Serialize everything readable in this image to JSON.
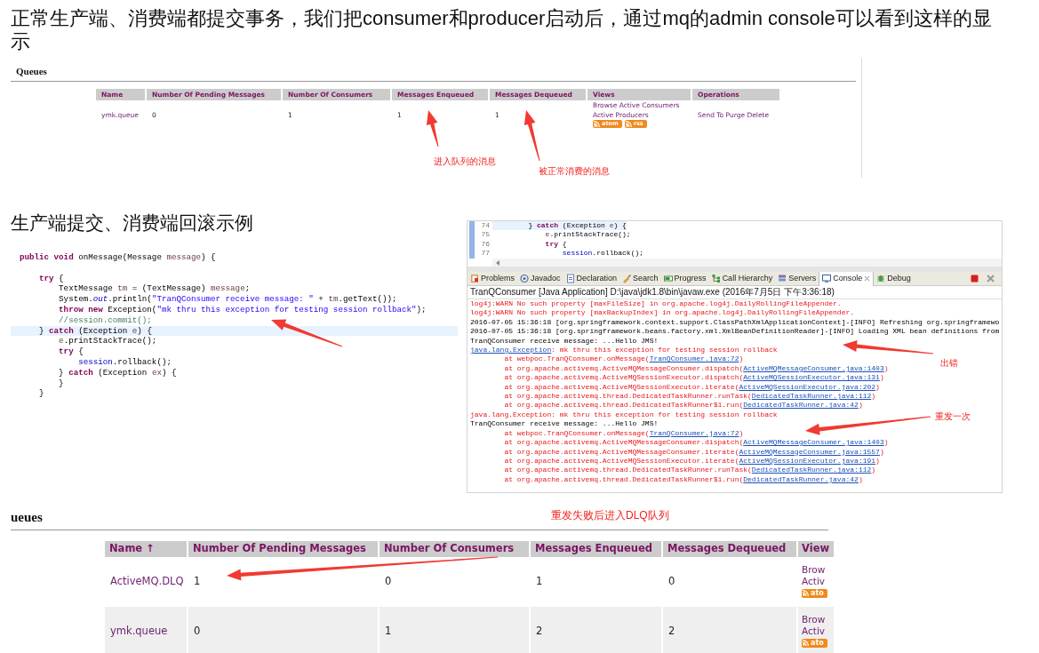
{
  "intro": "正常生产端、消费端都提交事务，我们把consumer和producer启动后，通过mq的admin console可以看到这样的显示",
  "queues_top": {
    "title": "Queues",
    "columns": [
      "Name",
      "Number Of Pending Messages",
      "Number Of Consumers",
      "Messages Enqueued",
      "Messages Dequeued",
      "Views",
      "Operations"
    ],
    "rows": [
      {
        "name": "ymk.queue",
        "pending": "0",
        "consumers": "1",
        "enqueued": "1",
        "dequeued": "1",
        "views": [
          "Browse Active Consumers",
          "Active Producers"
        ],
        "feeds": [
          "atom",
          "rss"
        ],
        "operations": [
          "Send To",
          "Purge",
          "Delete"
        ]
      }
    ]
  },
  "subtitle": "生产端提交、消费端回滚示例",
  "code": {
    "lines": [
      {
        "current": false,
        "tokens": [
          {
            "kind": "kw",
            "text": "public void"
          },
          {
            "kind": "p",
            "text": " onMessage(Message "
          },
          {
            "kind": "var",
            "text": "message"
          },
          {
            "kind": "p",
            "text": ") {"
          }
        ]
      },
      {
        "current": false,
        "tokens": [
          {
            "kind": "kw",
            "text": "    try"
          },
          {
            "kind": "p",
            "text": " {"
          }
        ]
      },
      {
        "current": false,
        "tokens": [
          {
            "kind": "p",
            "text": "        TextMessage "
          },
          {
            "kind": "var",
            "text": "tm"
          },
          {
            "kind": "p",
            "text": " = (TextMessage) "
          },
          {
            "kind": "var",
            "text": "message"
          },
          {
            "kind": "p",
            "text": ";"
          }
        ]
      },
      {
        "current": false,
        "tokens": [
          {
            "kind": "p",
            "text": "        System."
          },
          {
            "kind": "sf",
            "text": "out"
          },
          {
            "kind": "p",
            "text": ".println("
          },
          {
            "kind": "str",
            "text": "\"TranQConsumer receive message: \""
          },
          {
            "kind": "p",
            "text": " + "
          },
          {
            "kind": "var",
            "text": "tm"
          },
          {
            "kind": "p",
            "text": ".getText());"
          }
        ]
      },
      {
        "current": false,
        "tokens": [
          {
            "kind": "kw",
            "text": "        throw new"
          },
          {
            "kind": "p",
            "text": " Exception("
          },
          {
            "kind": "str",
            "text": "\"mk thru this exception for testing session rollback\""
          },
          {
            "kind": "p",
            "text": ");"
          }
        ]
      },
      {
        "current": false,
        "tokens": [
          {
            "kind": "cmt",
            "text": "        //session.commit();"
          }
        ]
      },
      {
        "current": true,
        "tokens": [
          {
            "kind": "p",
            "text": "    } "
          },
          {
            "kind": "kw",
            "text": "catch"
          },
          {
            "kind": "p",
            "text": " (Exception "
          },
          {
            "kind": "var",
            "text": "e"
          },
          {
            "kind": "p",
            "text": ") {"
          }
        ]
      },
      {
        "current": false,
        "tokens": [
          {
            "kind": "var",
            "text": "        e"
          },
          {
            "kind": "p",
            "text": ".printStackTrace();"
          }
        ]
      },
      {
        "current": false,
        "tokens": [
          {
            "kind": "kw",
            "text": "        try"
          },
          {
            "kind": "p",
            "text": " {"
          }
        ]
      },
      {
        "current": false,
        "tokens": [
          {
            "kind": "f",
            "text": "            session"
          },
          {
            "kind": "p",
            "text": ".rollback();"
          }
        ]
      },
      {
        "current": false,
        "tokens": [
          {
            "kind": "p",
            "text": "        } "
          },
          {
            "kind": "kw",
            "text": "catch"
          },
          {
            "kind": "p",
            "text": " (Exception "
          },
          {
            "kind": "var",
            "text": "ex"
          },
          {
            "kind": "p",
            "text": ") {"
          }
        ]
      },
      {
        "current": false,
        "tokens": [
          {
            "kind": "p",
            "text": "        }"
          }
        ]
      },
      {
        "current": false,
        "tokens": [
          {
            "kind": "p",
            "text": "    }"
          }
        ]
      }
    ]
  },
  "eclipse": {
    "editor_lines": [
      {
        "number": "74",
        "current": true,
        "tokens": [
          {
            "kind": "p",
            "text": "        } "
          },
          {
            "kind": "kw",
            "text": "catch"
          },
          {
            "kind": "p",
            "text": " (Exception "
          },
          {
            "kind": "var",
            "text": "e"
          },
          {
            "kind": "p",
            "text": ") {"
          }
        ]
      },
      {
        "number": "75",
        "current": false,
        "tokens": [
          {
            "kind": "var",
            "text": "            e"
          },
          {
            "kind": "p",
            "text": ".printStackTrace();"
          }
        ]
      },
      {
        "number": "76",
        "current": false,
        "tokens": [
          {
            "kind": "kw",
            "text": "            try"
          },
          {
            "kind": "p",
            "text": " {"
          }
        ]
      },
      {
        "number": "77",
        "current": false,
        "tokens": [
          {
            "kind": "f",
            "text": "                session"
          },
          {
            "kind": "p",
            "text": ".rollback();"
          }
        ]
      }
    ],
    "tabs": [
      {
        "label": "Problems",
        "selected": false
      },
      {
        "label": "Javadoc",
        "selected": false
      },
      {
        "label": "Declaration",
        "selected": false
      },
      {
        "label": "Search",
        "selected": false
      },
      {
        "label": "Progress",
        "selected": false
      },
      {
        "label": "Call Hierarchy",
        "selected": false
      },
      {
        "label": "Servers",
        "selected": false
      },
      {
        "label": "Console",
        "selected": true
      },
      {
        "label": "Debug",
        "selected": false
      }
    ],
    "console_title": "TranQConsumer [Java Application] D:\\java\\jdk1.8\\bin\\javaw.exe (2016年7月5日 下午3:36:18)",
    "console_lines": [
      [
        {
          "kind": "err",
          "text": "log4j:WARN No such property [maxFileSize] in org.apache.log4j.DailyRollingFileAppender."
        }
      ],
      [
        {
          "kind": "err",
          "text": "log4j:WARN No such property [maxBackupIndex] in org.apache.log4j.DailyRollingFileAppender."
        }
      ],
      [
        {
          "kind": "out",
          "text": "2016-07-05 15:36:18 [org.springframework.context.support.ClassPathXmlApplicationContext]-[INFO] Refreshing org.springframewo"
        }
      ],
      [
        {
          "kind": "out",
          "text": "2016-07-05 15:36:18 [org.springframework.beans.factory.xml.XmlBeanDefinitionReader]-[INFO] Loading XML bean definitions from"
        }
      ],
      [
        {
          "kind": "out",
          "text": "TranQConsumer receive message: ...Hello JMS!"
        }
      ],
      [
        {
          "kind": "link",
          "text": "java.lang.Exception"
        },
        {
          "kind": "err",
          "text": ": mk thru this exception for testing session rollback"
        }
      ],
      [
        {
          "kind": "err",
          "text": "        at webpoc.TranQConsumer.onMessage("
        },
        {
          "kind": "link",
          "text": "TranQConsumer.java:72"
        },
        {
          "kind": "err",
          "text": ")"
        }
      ],
      [
        {
          "kind": "err",
          "text": "        at org.apache.activemq.ActiveMQMessageConsumer.dispatch("
        },
        {
          "kind": "link",
          "text": "ActiveMQMessageConsumer.java:1403"
        },
        {
          "kind": "err",
          "text": ")"
        }
      ],
      [
        {
          "kind": "err",
          "text": "        at org.apache.activemq.ActiveMQSessionExecutor.dispatch("
        },
        {
          "kind": "link",
          "text": "ActiveMQSessionExecutor.java:131"
        },
        {
          "kind": "err",
          "text": ")"
        }
      ],
      [
        {
          "kind": "err",
          "text": "        at org.apache.activemq.ActiveMQSessionExecutor.iterate("
        },
        {
          "kind": "link",
          "text": "ActiveMQSessionExecutor.java:202"
        },
        {
          "kind": "err",
          "text": ")"
        }
      ],
      [
        {
          "kind": "err",
          "text": "        at org.apache.activemq.thread.DedicatedTaskRunner.runTask("
        },
        {
          "kind": "link",
          "text": "DedicatedTaskRunner.java:112"
        },
        {
          "kind": "err",
          "text": ")"
        }
      ],
      [
        {
          "kind": "err",
          "text": "        at org.apache.activemq.thread.DedicatedTaskRunner$1.run("
        },
        {
          "kind": "link",
          "text": "DedicatedTaskRunner.java:42"
        },
        {
          "kind": "err",
          "text": ")"
        }
      ],
      [
        {
          "kind": "err",
          "text": "java.lang.Exception: mk thru this exception for testing session rollback"
        }
      ],
      [
        {
          "kind": "out",
          "text": "TranQConsumer receive message: ...Hello JMS!"
        }
      ],
      [
        {
          "kind": "err",
          "text": "        at webpoc.TranQConsumer.onMessage("
        },
        {
          "kind": "link",
          "text": "TranQConsumer.java:72"
        },
        {
          "kind": "err",
          "text": ")"
        }
      ],
      [
        {
          "kind": "err",
          "text": "        at org.apache.activemq.ActiveMQMessageConsumer.dispatch("
        },
        {
          "kind": "link",
          "text": "ActiveMQMessageConsumer.java:1403"
        },
        {
          "kind": "err",
          "text": ")"
        }
      ],
      [
        {
          "kind": "err",
          "text": "        at org.apache.activemq.ActiveMQMessageConsumer.iterate("
        },
        {
          "kind": "link",
          "text": "ActiveMQMessageConsumer.java:1557"
        },
        {
          "kind": "err",
          "text": ")"
        }
      ],
      [
        {
          "kind": "err",
          "text": "        at org.apache.activemq.ActiveMQSessionExecutor.iterate("
        },
        {
          "kind": "link",
          "text": "ActiveMQSessionExecutor.java:191"
        },
        {
          "kind": "err",
          "text": ")"
        }
      ],
      [
        {
          "kind": "err",
          "text": "        at org.apache.activemq.thread.DedicatedTaskRunner.runTask("
        },
        {
          "kind": "link",
          "text": "DedicatedTaskRunner.java:112"
        },
        {
          "kind": "err",
          "text": ")"
        }
      ],
      [
        {
          "kind": "err",
          "text": "        at org.apache.activemq.thread.DedicatedTaskRunner$1.run("
        },
        {
          "kind": "link",
          "text": "DedicatedTaskRunner.java:42"
        },
        {
          "kind": "err",
          "text": ")"
        }
      ]
    ]
  },
  "queues_bottom": {
    "title": "ueues",
    "columns": [
      "Name ↑",
      "Number Of Pending Messages",
      "Number Of Consumers",
      "Messages Enqueued",
      "Messages Dequeued",
      "View"
    ],
    "rows": [
      {
        "name": "ActiveMQ.DLQ",
        "pending": "1",
        "consumers": "0",
        "enqueued": "1",
        "dequeued": "0",
        "views": [
          "Brow",
          "Activ"
        ],
        "feeds": [
          "ato"
        ]
      },
      {
        "name": "ymk.queue",
        "pending": "0",
        "consumers": "1",
        "enqueued": "2",
        "dequeued": "2",
        "views": [
          "Brow",
          "Activ"
        ],
        "feeds": [
          "ato"
        ]
      }
    ]
  },
  "annotations": [
    {
      "text": "进入队列的消息"
    },
    {
      "text": "被正常消费的消息"
    },
    {
      "text": "出错"
    },
    {
      "text": "重发一次"
    },
    {
      "text": "重发失败后进入DLQ队列"
    }
  ]
}
